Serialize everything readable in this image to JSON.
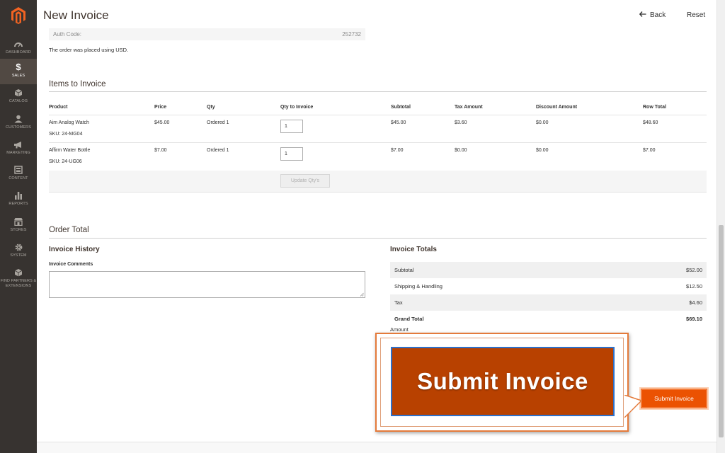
{
  "sidebar": {
    "items": [
      {
        "label": "DASHBOARD",
        "icon": "dashboard-icon"
      },
      {
        "label": "SALES",
        "icon": "dollar-icon"
      },
      {
        "label": "CATALOG",
        "icon": "box-icon"
      },
      {
        "label": "CUSTOMERS",
        "icon": "customers-icon"
      },
      {
        "label": "MARKETING",
        "icon": "megaphone-icon"
      },
      {
        "label": "CONTENT",
        "icon": "content-icon"
      },
      {
        "label": "REPORTS",
        "icon": "bar-chart-icon"
      },
      {
        "label": "STORES",
        "icon": "store-icon"
      },
      {
        "label": "SYSTEM",
        "icon": "gear-icon"
      },
      {
        "label": "FIND PARTNERS & EXTENSIONS",
        "icon": "extensions-icon"
      }
    ],
    "active": "SALES"
  },
  "header": {
    "title": "New Invoice",
    "back_label": "Back",
    "reset_label": "Reset"
  },
  "payment": {
    "auth_code_label": "Auth Code:",
    "auth_code_value": "252732",
    "currency_note": "The order was placed using USD."
  },
  "items_section": {
    "title": "Items to Invoice",
    "columns": [
      "Product",
      "Price",
      "Qty",
      "Qty to Invoice",
      "Subtotal",
      "Tax Amount",
      "Discount Amount",
      "Row Total"
    ],
    "rows": [
      {
        "product": "Aim Analog Watch",
        "sku": "SKU: 24-MG04",
        "price": "$45.00",
        "qty": "Ordered 1",
        "qty_to_invoice": "1",
        "subtotal": "$45.00",
        "tax": "$3.60",
        "discount": "$0.00",
        "row_total": "$48.60"
      },
      {
        "product": "Affirm Water Bottle",
        "sku": "SKU: 24-UG06",
        "price": "$7.00",
        "qty": "Ordered 1",
        "qty_to_invoice": "1",
        "subtotal": "$7.00",
        "tax": "$0.00",
        "discount": "$0.00",
        "row_total": "$7.00"
      }
    ],
    "update_label": "Update Qty's"
  },
  "order_total": {
    "title": "Order Total",
    "history_title": "Invoice History",
    "comments_label": "Invoice Comments",
    "totals_title": "Invoice Totals",
    "totals": [
      {
        "label": "Subtotal",
        "value": "$52.00"
      },
      {
        "label": "Shipping & Handling",
        "value": "$12.50"
      },
      {
        "label": "Tax",
        "value": "$4.60"
      },
      {
        "label": "Grand Total",
        "value": "$69.10"
      }
    ],
    "amount_label": "Amount",
    "submit_label": "Submit Invoice"
  },
  "callout": {
    "label": "Submit Invoice"
  },
  "colors": {
    "sidebar_bg": "#373330",
    "accent": "#eb5202",
    "callout_btn": "#b84100"
  }
}
